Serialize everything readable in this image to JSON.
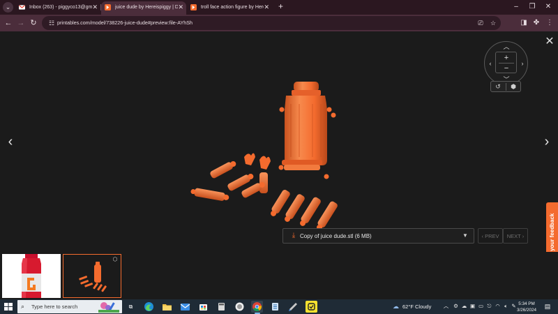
{
  "browser": {
    "tabs": [
      {
        "title": "Inbox (263) - piggyco13@gmai",
        "favicon": "gmail-icon",
        "active": false
      },
      {
        "title": "juice dude by Hereispiggy | Do",
        "favicon": "printables-icon",
        "active": true
      },
      {
        "title": "troll face action figure by Herei",
        "favicon": "printables-icon",
        "active": false
      }
    ],
    "tab_close_glyph": "✕",
    "new_tab_glyph": "+",
    "window_controls": {
      "minimize": "–",
      "maximize": "❐",
      "close": "✕"
    },
    "url": "printables.com/model/738226-juice-dude#preview:file-AYhSh"
  },
  "viewer": {
    "close_glyph": "✕",
    "prev_arrow": "‹",
    "next_arrow": "›",
    "file_label": "Copy of juice dude.stl (6 MB)",
    "prev_label": "‹ PREV",
    "next_label": "NEXT ›",
    "feedback_label": "Share your feedback",
    "model_color": "#f46b2e",
    "accent_color": "#f46b2e"
  },
  "taskbar": {
    "search_placeholder": "Type here to search",
    "weather_text": "62°F  Cloudy",
    "time": "5:34 PM",
    "date": "3/26/2024",
    "notification_count": "2"
  }
}
